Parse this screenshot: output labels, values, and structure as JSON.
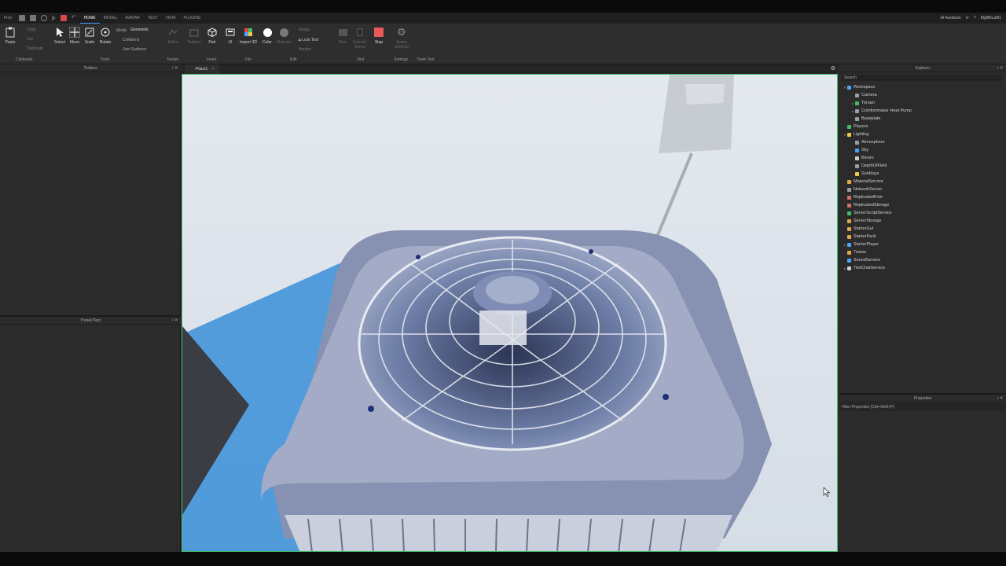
{
  "menu": [
    "FILE",
    "HOME",
    "MODEL",
    "AVATAR",
    "TEST",
    "VIEW",
    "PLUGINS"
  ],
  "active_menu": "HOME",
  "topbar_right": {
    "ai_assistant": "AI Assistant",
    "user": "BigBillLaM1"
  },
  "ribbon": {
    "paste": "Paste",
    "copy": "Copy",
    "cut": "Cut",
    "duplicate": "Duplicate",
    "select": "Select",
    "move": "Move",
    "scale": "Scale",
    "rotate": "Rotate",
    "mode_label": "Mode:",
    "mode_value": "Geometric",
    "collisions": "Collisions",
    "join_surfaces": "Join Surfaces",
    "editor": "Editor",
    "toolbox": "Toolbox",
    "part": "Part",
    "ui": "UI",
    "import3d": "Import 3D",
    "color": "Color",
    "material": "Material",
    "group": "Group",
    "lock_tool": "Lock Tool",
    "anchor": "Anchor",
    "run": "Run",
    "current_server": "Current: Server",
    "stop": "Stop",
    "game_settings": "Game Settings",
    "groups": {
      "clipboard": "Clipboard",
      "tools": "Tools",
      "terrain": "Terrain",
      "insert": "Insert",
      "file": "File",
      "edit": "Edit",
      "test": "Test",
      "settings": "Settings",
      "team_test": "Team Test"
    }
  },
  "left": {
    "toolbox_title": "Toolbox",
    "three_d_text_title": "ThreeDText"
  },
  "doc_tab": "Place1",
  "explorer": {
    "title": "Explorer",
    "search_placeholder": "Search",
    "items": [
      {
        "label": "Workspace",
        "indent": 0,
        "arrow": "▾",
        "color": "#4aa3ff"
      },
      {
        "label": "Camera",
        "indent": 1,
        "arrow": "",
        "color": "#9aa0a6"
      },
      {
        "label": "Terrain",
        "indent": 1,
        "arrow": "▸",
        "color": "#3fbf6a"
      },
      {
        "label": "Comfortmaker Heat Pump",
        "indent": 1,
        "arrow": "▸",
        "color": "#9aa0a6"
      },
      {
        "label": "Baseplate",
        "indent": 1,
        "arrow": "",
        "color": "#9aa0a6"
      },
      {
        "label": "Players",
        "indent": 0,
        "arrow": "",
        "color": "#3fbf6a"
      },
      {
        "label": "Lighting",
        "indent": 0,
        "arrow": "▾",
        "color": "#f2c94c"
      },
      {
        "label": "Atmosphere",
        "indent": 1,
        "arrow": "",
        "color": "#9aa0a6"
      },
      {
        "label": "Sky",
        "indent": 1,
        "arrow": "",
        "color": "#4aa3ff"
      },
      {
        "label": "Bloom",
        "indent": 1,
        "arrow": "",
        "color": "#cfcfcf"
      },
      {
        "label": "DepthOfField",
        "indent": 1,
        "arrow": "",
        "color": "#9aa0a6"
      },
      {
        "label": "SunRays",
        "indent": 1,
        "arrow": "",
        "color": "#f2c94c"
      },
      {
        "label": "MaterialService",
        "indent": 0,
        "arrow": "",
        "color": "#e8a44a"
      },
      {
        "label": "NetworkServer",
        "indent": 0,
        "arrow": "",
        "color": "#9aa0a6"
      },
      {
        "label": "ReplicatedFirst",
        "indent": 0,
        "arrow": "",
        "color": "#d96c6c"
      },
      {
        "label": "ReplicatedStorage",
        "indent": 0,
        "arrow": "",
        "color": "#d96c6c"
      },
      {
        "label": "ServerScriptService",
        "indent": 0,
        "arrow": "",
        "color": "#3fbf6a"
      },
      {
        "label": "ServerStorage",
        "indent": 0,
        "arrow": "",
        "color": "#e8a44a"
      },
      {
        "label": "StarterGui",
        "indent": 0,
        "arrow": "",
        "color": "#e8a44a"
      },
      {
        "label": "StarterPack",
        "indent": 0,
        "arrow": "",
        "color": "#e8a44a"
      },
      {
        "label": "StarterPlayer",
        "indent": 0,
        "arrow": "▸",
        "color": "#4aa3ff"
      },
      {
        "label": "Teams",
        "indent": 0,
        "arrow": "",
        "color": "#e8a44a"
      },
      {
        "label": "SoundService",
        "indent": 0,
        "arrow": "",
        "color": "#4aa3ff"
      },
      {
        "label": "TextChatService",
        "indent": 0,
        "arrow": "▸",
        "color": "#cfcfcf"
      }
    ]
  },
  "properties": {
    "title": "Properties",
    "filter_placeholder": "Filter Properties (Ctrl+Shift+P)"
  }
}
